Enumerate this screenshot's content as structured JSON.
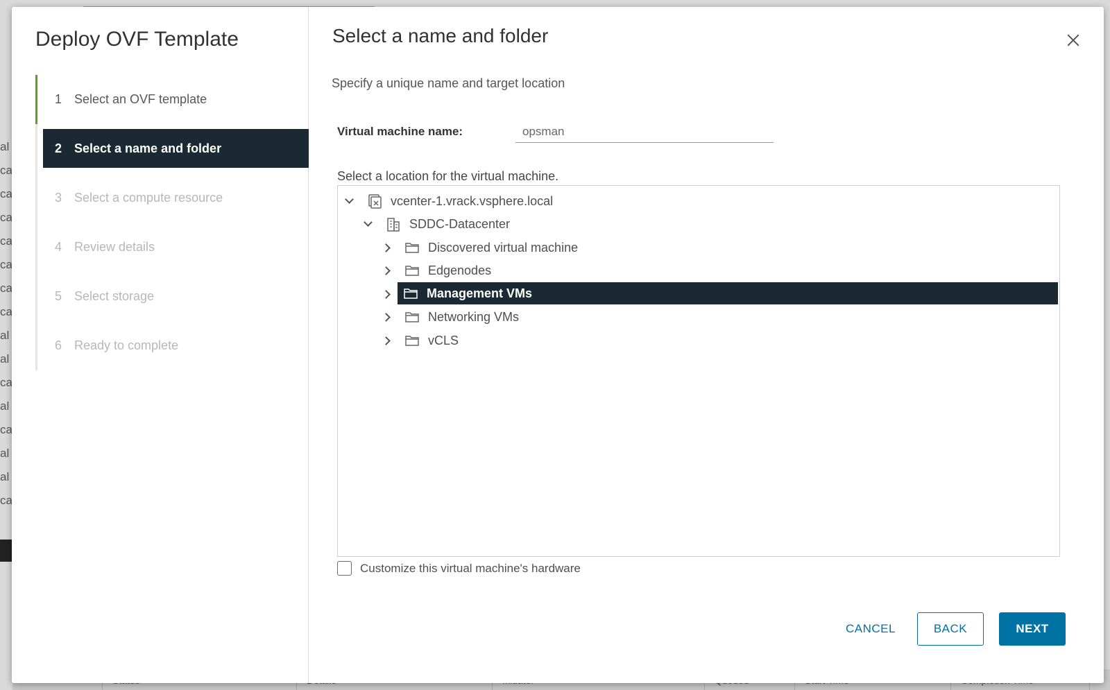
{
  "background": {
    "left_col_fragments": [
      "al",
      "ca",
      "cal",
      "ca",
      "ca",
      "ca",
      "ca",
      "ca",
      "al",
      "al",
      "cal",
      "al",
      "cal",
      "al",
      "al",
      "cal"
    ],
    "table_headers": [
      "Status",
      "Details",
      "Initiator",
      "Queued",
      "Start Time",
      "Completion Time"
    ]
  },
  "wizard": {
    "title": "Deploy OVF Template",
    "steps": [
      {
        "num": "1",
        "label": "Select an OVF template"
      },
      {
        "num": "2",
        "label": "Select a name and folder"
      },
      {
        "num": "3",
        "label": "Select a compute resource"
      },
      {
        "num": "4",
        "label": "Review details"
      },
      {
        "num": "5",
        "label": "Select storage"
      },
      {
        "num": "6",
        "label": "Ready to complete"
      }
    ]
  },
  "page": {
    "title": "Select a name and folder",
    "subtitle": "Specify a unique name and target location",
    "vm_name_label": "Virtual machine name:",
    "vm_name_value": "opsman",
    "location_label": "Select a location for the virtual machine.",
    "customize_label": "Customize this virtual machine's hardware",
    "customize_checked": false
  },
  "tree": {
    "vcenter": "vcenter-1.vrack.vsphere.local",
    "datacenter": "SDDC-Datacenter",
    "folders": [
      "Discovered virtual machine",
      "Edgenodes",
      "Management VMs",
      "Networking VMs",
      "vCLS"
    ],
    "selected": "Management VMs"
  },
  "buttons": {
    "cancel": "CANCEL",
    "back": "BACK",
    "next": "NEXT"
  },
  "colors": {
    "accent": "#0072a3",
    "selected_bg": "#1b2a32",
    "done_step": "#5aa220"
  }
}
